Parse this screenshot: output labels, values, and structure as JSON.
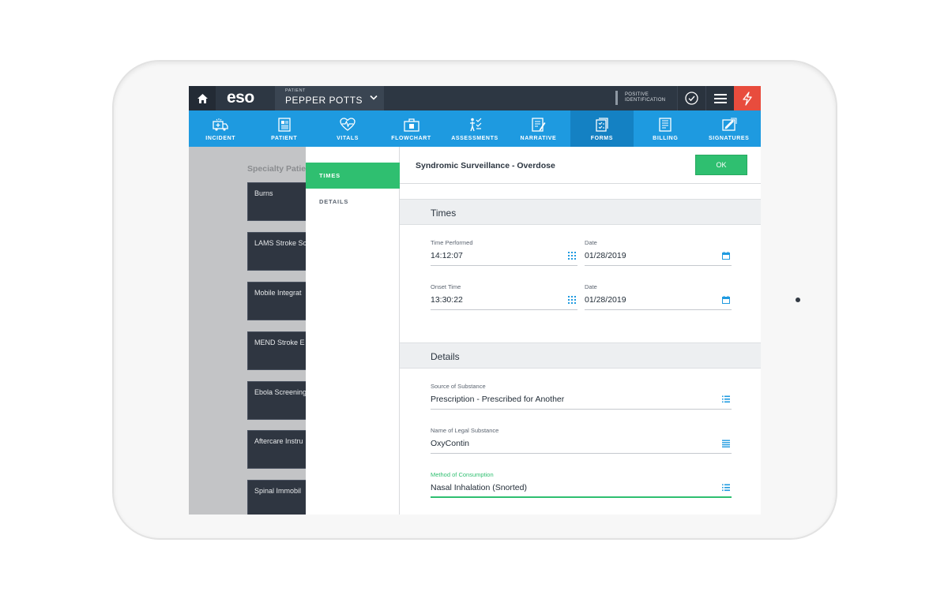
{
  "topbar": {
    "logo": "eso",
    "patient_label": "PATIENT",
    "patient_name": "PEPPER POTTS",
    "positive_id_line1": "POSITIVE",
    "positive_id_line2": "IDENTIFICATION"
  },
  "nav": {
    "tabs": [
      {
        "label": "INCIDENT",
        "icon": "ambulance-icon"
      },
      {
        "label": "PATIENT",
        "icon": "patient-card-icon"
      },
      {
        "label": "VITALS",
        "icon": "heart-pulse-icon"
      },
      {
        "label": "FLOWCHART",
        "icon": "medkit-icon"
      },
      {
        "label": "ASSESSMENTS",
        "icon": "body-icon"
      },
      {
        "label": "NARRATIVE",
        "icon": "pencil-doc-icon"
      },
      {
        "label": "FORMS",
        "icon": "forms-icon",
        "active": true
      },
      {
        "label": "BILLING",
        "icon": "billing-icon"
      },
      {
        "label": "SIGNATURES",
        "icon": "signature-icon"
      }
    ]
  },
  "background": {
    "title": "Specialty Patie",
    "cards": [
      "Burns",
      "LAMS Stroke Sc",
      "Mobile Integrat",
      "MEND Stroke E",
      "Ebola Screening",
      "Aftercare Instru",
      "Spinal Immobil"
    ]
  },
  "modal": {
    "side": {
      "times": "TIMES",
      "details": "DETAILS"
    },
    "title": "Syndromic Surveillance - Overdose",
    "ok_label": "OK",
    "times_section": "Times",
    "time_performed_label": "Time Performed",
    "time_performed_value": "14:12:07",
    "date1_label": "Date",
    "date1_value": "01/28/2019",
    "onset_time_label": "Onset Time",
    "onset_time_value": "13:30:22",
    "date2_label": "Date",
    "date2_value": "01/28/2019",
    "details_section": "Details",
    "source_label": "Source of Substance",
    "source_value": "Prescription - Prescribed for Another",
    "legal_label": "Name of Legal Substance",
    "legal_value": "OxyContin",
    "method_label": "Method of Consumption",
    "method_value": "Nasal Inhalation (Snorted)"
  },
  "colors": {
    "topbar": "#2d3743",
    "nav": "#1e9ae0",
    "nav_active": "#1481c3",
    "accent_green": "#2fbf70",
    "alert_red": "#e84c3d",
    "icon_blue": "#1e9ae0"
  }
}
